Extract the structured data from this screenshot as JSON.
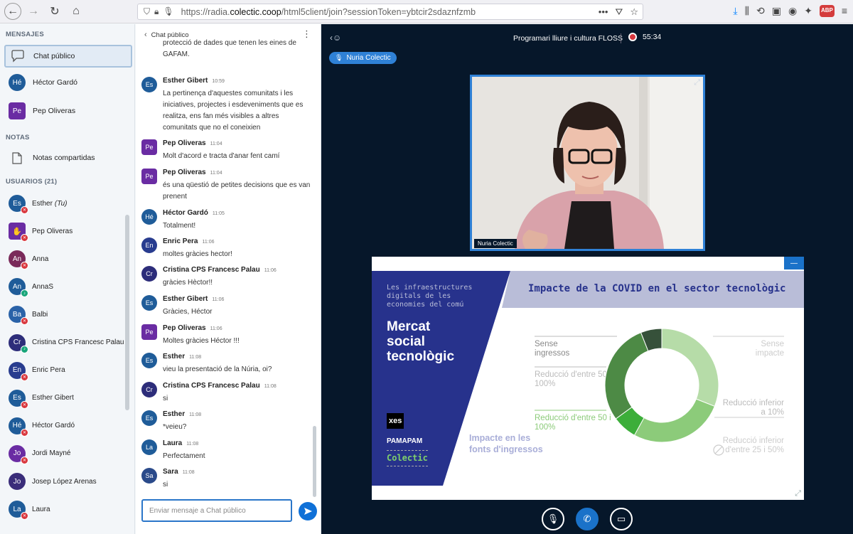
{
  "browser": {
    "url_prefix": "https://radia.",
    "url_domain": "colectic.coop",
    "url_suffix": "/html5client/join?sessionToken=ybtcir2sdaznfzmb",
    "dots": "•••"
  },
  "left": {
    "messages_title": "MENSAJES",
    "chats": [
      {
        "label": "Chat público",
        "initials": ""
      },
      {
        "label": "Héctor Gardó",
        "initials": "Hé",
        "color": "#1f5c99"
      },
      {
        "label": "Pep Oliveras",
        "initials": "Pe",
        "color": "#6a2ca3"
      }
    ],
    "notes_title": "NOTAS",
    "notes_label": "Notas compartidas",
    "users_title": "USUARIOS (21)",
    "users": [
      {
        "initials": "Es",
        "name": "Esther",
        "you": "(Tu)",
        "color": "#1f5c99",
        "badge": "red",
        "square": false
      },
      {
        "initials": "",
        "name": "Pep Oliveras",
        "color": "#6a2ca3",
        "badge": "red",
        "square": true
      },
      {
        "initials": "An",
        "name": "Anna",
        "color": "#7a2a5a",
        "badge": "red",
        "square": false
      },
      {
        "initials": "An",
        "name": "AnnaS",
        "color": "#1f5c99",
        "badge": "green",
        "square": false
      },
      {
        "initials": "Ba",
        "name": "Balbi",
        "color": "#2a62a8",
        "badge": "red",
        "square": false
      },
      {
        "initials": "Cr",
        "name": "Cristina CPS Francesc Palau",
        "color": "#2d2d7a",
        "badge": "green",
        "square": false
      },
      {
        "initials": "En",
        "name": "Enric Pera",
        "color": "#283c8f",
        "badge": "red",
        "square": false
      },
      {
        "initials": "Es",
        "name": "Esther Gibert",
        "color": "#1f5c99",
        "badge": "red",
        "square": false
      },
      {
        "initials": "Hé",
        "name": "Héctor Gardó",
        "color": "#1f5c99",
        "badge": "red",
        "square": false
      },
      {
        "initials": "Jo",
        "name": "Jordi Mayné",
        "color": "#6a2ca3",
        "badge": "red",
        "square": false
      },
      {
        "initials": "Jo",
        "name": "Josep López Arenas",
        "color": "#3a2d7a",
        "badge": "none",
        "square": false
      },
      {
        "initials": "La",
        "name": "Laura",
        "color": "#1f5c99",
        "badge": "red",
        "square": false
      }
    ]
  },
  "chat": {
    "title": "Chat público",
    "top_fragment": "protecció de dades que tenen les eines de GAFAM.",
    "messages": [
      {
        "initials": "Es",
        "name": "Esther Gibert",
        "time": "10:59",
        "text": "La pertinença d'aquestes comunitats i les iniciatives, projectes i esdeveniments que es realitza, ens fan més visibles a altres comunitats que no el coneixien",
        "color": "#1f5c99",
        "sq": false
      },
      {
        "initials": "Pe",
        "name": "Pep Oliveras",
        "time": "11:04",
        "text": "Molt d'acord e tracta d'anar fent camí",
        "color": "#6a2ca3",
        "sq": true
      },
      {
        "initials": "Pe",
        "name": "Pep Oliveras",
        "time": "11:04",
        "text": "és una qüestió de petites decisions que es van prenent",
        "color": "#6a2ca3",
        "sq": true
      },
      {
        "initials": "Hé",
        "name": "Héctor Gardó",
        "time": "11:05",
        "text": "Totalment!",
        "color": "#1f5c99",
        "sq": false
      },
      {
        "initials": "En",
        "name": "Enric Pera",
        "time": "11:06",
        "text": "moltes gràcies hector!",
        "color": "#283c8f",
        "sq": false
      },
      {
        "initials": "Cr",
        "name": "Cristina CPS Francesc Palau",
        "time": "11:06",
        "text": "gràcies Hèctor!!",
        "color": "#2d2d7a",
        "sq": false
      },
      {
        "initials": "Es",
        "name": "Esther Gibert",
        "time": "11:06",
        "text": "Gràcies, Héctor",
        "color": "#1f5c99",
        "sq": false
      },
      {
        "initials": "Pe",
        "name": "Pep Oliveras",
        "time": "11:06",
        "text": "Moltes gràcies Héctor !!!",
        "color": "#6a2ca3",
        "sq": true
      },
      {
        "initials": "Es",
        "name": "Esther",
        "time": "11:08",
        "text": "vieu la presentació de la Núria, oi?",
        "color": "#1f5c99",
        "sq": false
      },
      {
        "initials": "Cr",
        "name": "Cristina CPS Francesc Palau",
        "time": "11:08",
        "text": "si",
        "color": "#2d2d7a",
        "sq": false
      },
      {
        "initials": "Es",
        "name": "Esther",
        "time": "11:08",
        "text": "*veieu?",
        "color": "#1f5c99",
        "sq": false
      },
      {
        "initials": "La",
        "name": "Laura",
        "time": "11:08",
        "text": "Perfectament",
        "color": "#1f5c99",
        "sq": false
      },
      {
        "initials": "Sa",
        "name": "Sara",
        "time": "11:08",
        "text": "si",
        "color": "#2a4a8a",
        "sq": false
      }
    ],
    "input_placeholder": "Enviar mensaje a Chat público"
  },
  "main": {
    "meeting_title": "Programari lliure i cultura FLOSS",
    "timer": "55:34",
    "talker": "Nuria Colectic",
    "video_label": "Nuria Colectic"
  },
  "slide": {
    "small_heading": "Les infraestructures digitals de les economies del comú",
    "big_heading": "Mercat social tecnològic",
    "banner": "Impacte de la COVID en el sector tecnològic",
    "logo_xes": "xes",
    "logo_pamapam": "PAMAPAM",
    "logo_colectic": "Colectic",
    "chart_title": "Impacte en les fonts d'ingressos",
    "labels": {
      "l1": "Sense ingressos",
      "l2": "Reducció d'entre 50 i 100%",
      "l3": "Reducció d'entre 50 i 100%",
      "r1": "Sense impacte",
      "r2": "Reducció inferior a 10%",
      "r3": "Reducció inferior d'entre 25 i 50%"
    }
  },
  "chart_data": {
    "type": "pie",
    "title": "Impacte en les fonts d'ingressos",
    "slices": [
      {
        "label": "Sense impacte",
        "value": 31,
        "color": "#b6dca8"
      },
      {
        "label": "Reducció inferior a 10%",
        "value": 27,
        "color": "#8ccb7a"
      },
      {
        "label": "Reducció inferior d'entre 25 i 50%",
        "value": 0,
        "color": "#cccccc"
      },
      {
        "label": "Reducció d'entre 50 i 100%",
        "value": 7,
        "color": "#3cae3a"
      },
      {
        "label": "Reducció d'entre 50 i 100%",
        "value": 29,
        "color": "#4d8a45"
      },
      {
        "label": "Sense ingressos",
        "value": 6,
        "color": "#36513a"
      }
    ]
  }
}
